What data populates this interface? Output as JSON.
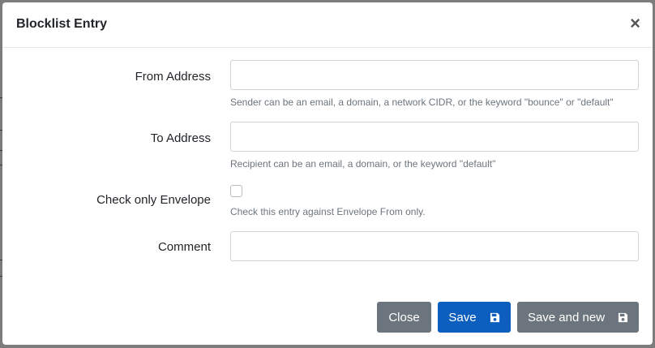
{
  "dialog": {
    "title": "Blocklist Entry",
    "close_glyph": "×"
  },
  "form": {
    "from_address": {
      "label": "From Address",
      "value": "",
      "help": "Sender can be an email, a domain, a network CIDR, or the keyword \"bounce\" or \"default\""
    },
    "to_address": {
      "label": "To Address",
      "value": "",
      "help": "Recipient can be an email, a domain, or the keyword \"default\""
    },
    "check_only_envelope": {
      "label": "Check only Envelope",
      "checked": false,
      "help": "Check this entry against Envelope From only."
    },
    "comment": {
      "label": "Comment",
      "value": ""
    }
  },
  "footer": {
    "close_label": "Close",
    "save_label": "Save",
    "save_new_label": "Save and new",
    "save_icon": "floppy-disk-icon",
    "save_color": "#0d5fbf",
    "secondary_color": "#6c757d"
  }
}
